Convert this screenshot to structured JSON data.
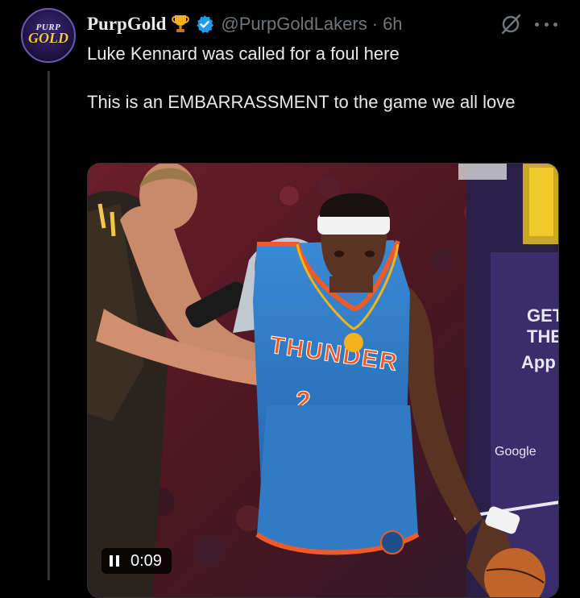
{
  "author": {
    "display_name": "PurpGold",
    "handle": "@PurpGoldLakers",
    "separator": "·",
    "time": "6h",
    "avatar_top": "PURP",
    "avatar_bottom": "GOLD",
    "icons": [
      "trophy-icon",
      "verified-badge-icon"
    ]
  },
  "tweet": {
    "line1": "Luke Kennard was called for a foul here",
    "line2": "This is an EMBARRASSMENT to the game we all love"
  },
  "media": {
    "jersey_name": "THUNDER",
    "jersey_number": "2",
    "board_line1": "GET",
    "board_line2": "THE",
    "board_line3": "App",
    "sponsor": "Google",
    "duration": "0:09",
    "icons": [
      "pause-icon"
    ]
  },
  "header_icons": [
    "grok-icon",
    "more-icon"
  ],
  "colors": {
    "background": "#000000",
    "text": "#e7e9ea",
    "muted": "#71767b",
    "verified": "#1d9bf0",
    "gold": "#f1c84b",
    "thunder_blue": "#2f7cc4",
    "thunder_orange": "#f05a28"
  }
}
